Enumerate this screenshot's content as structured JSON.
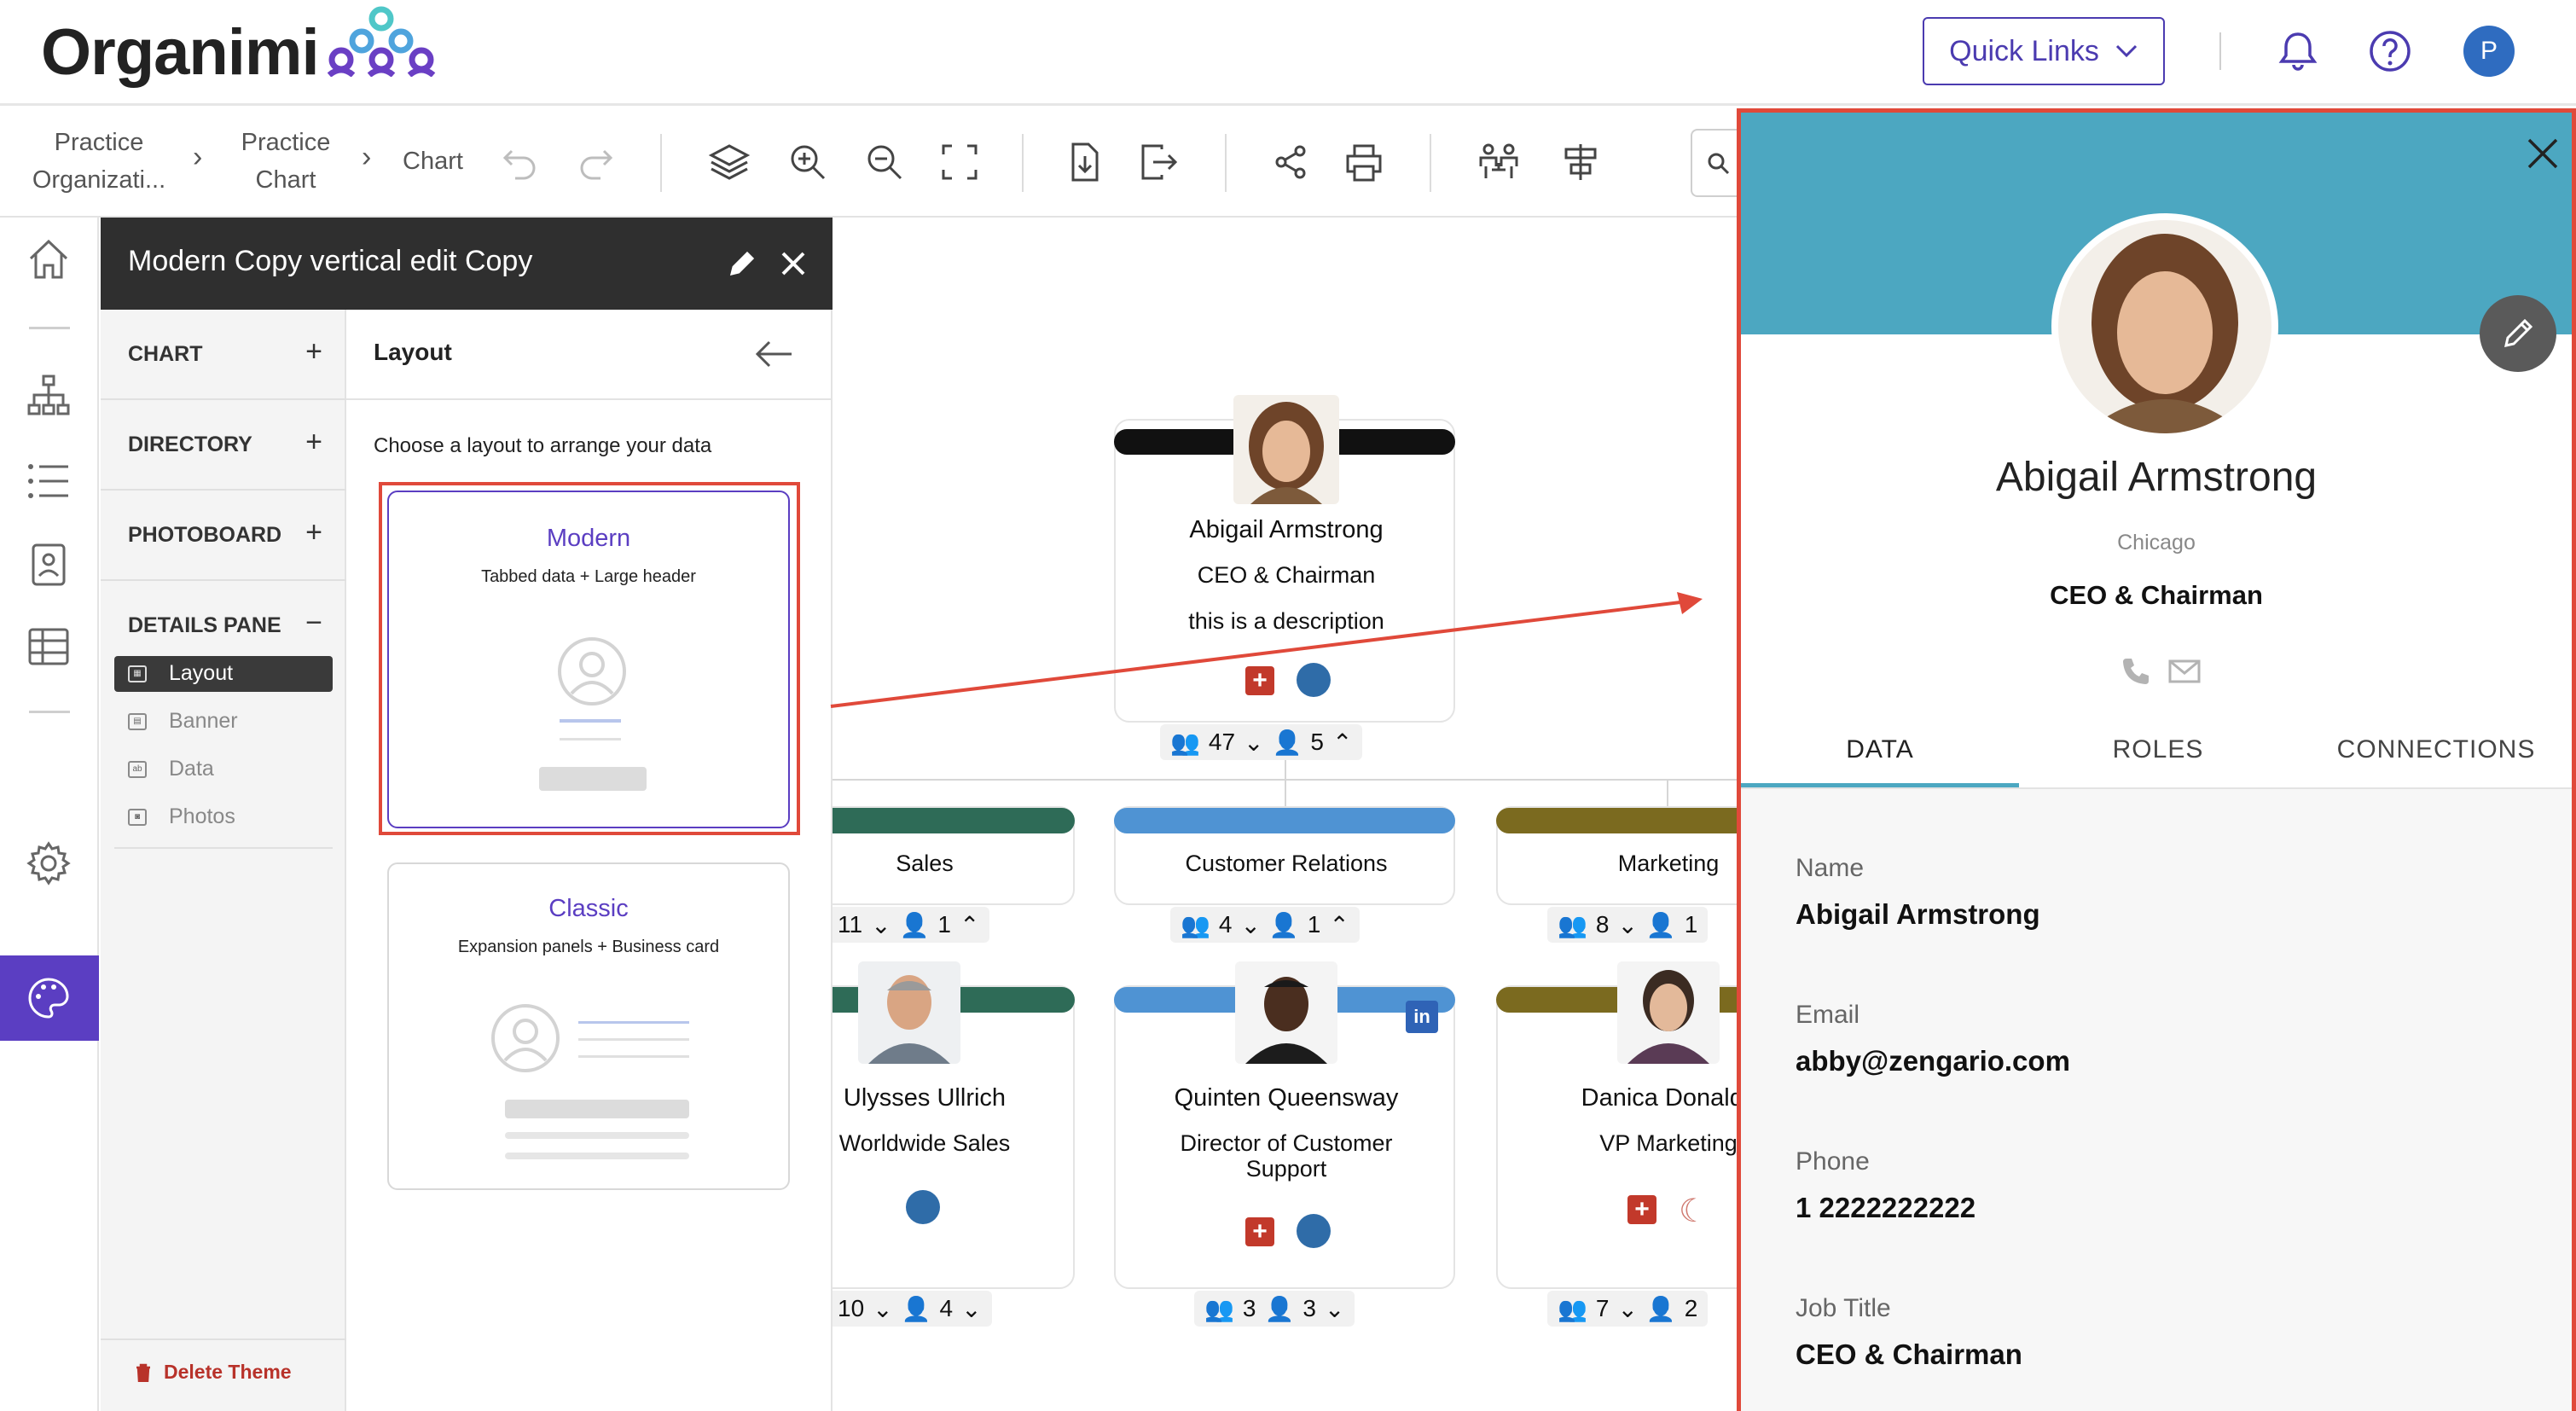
{
  "header": {
    "logo_text": "Organimi",
    "quick_links_label": "Quick Links",
    "user_initial": "P"
  },
  "breadcrumb": {
    "items": [
      {
        "line1": "Practice",
        "line2": "Organizati..."
      },
      {
        "line1": "Practice",
        "line2": "Chart"
      },
      {
        "line1": "Chart",
        "line2": ""
      }
    ]
  },
  "theme_panel": {
    "title": "Modern Copy vertical edit Copy",
    "sections": [
      {
        "label": "CHART",
        "sign": "+"
      },
      {
        "label": "DIRECTORY",
        "sign": "+"
      },
      {
        "label": "PHOTOBOARD",
        "sign": "+"
      },
      {
        "label": "DETAILS PANE",
        "sign": "−"
      }
    ],
    "sub_items": [
      {
        "label": "Layout",
        "active": true
      },
      {
        "label": "Banner",
        "active": false
      },
      {
        "label": "Data",
        "active": false
      },
      {
        "label": "Photos",
        "active": false
      }
    ],
    "delete_label": "Delete Theme"
  },
  "layout_pane": {
    "title": "Layout",
    "description": "Choose a layout to arrange your data",
    "options": [
      {
        "title": "Modern",
        "subtitle": "Tabbed data + Large header",
        "selected": true
      },
      {
        "title": "Classic",
        "subtitle": "Expansion panels + Business card",
        "selected": false
      }
    ]
  },
  "org_chart": {
    "root": {
      "name": "Abigail Armstrong",
      "title": "CEO & Chairman",
      "description": "this is a description",
      "total_count": "47",
      "direct_count": "5"
    },
    "departments": [
      {
        "name": "Sales",
        "total": "11",
        "direct": "1",
        "color": "#2e6b57"
      },
      {
        "name": "Customer Relations",
        "total": "4",
        "direct": "1",
        "color": "#4f93d3"
      },
      {
        "name": "Marketing",
        "total": "8",
        "direct": "1",
        "color": "#7b6a1f"
      }
    ],
    "people": [
      {
        "name": "Ulysses Ullrich",
        "title": "Worldwide Sales",
        "total": "10",
        "direct": "4"
      },
      {
        "name": "Quinten Queensway",
        "title": "Director of Customer Support",
        "total": "3",
        "direct": "3"
      },
      {
        "name": "Danica Donalds",
        "title": "VP Marketing",
        "total": "7",
        "direct": "2"
      }
    ]
  },
  "details": {
    "name": "Abigail Armstrong",
    "location": "Chicago",
    "title": "CEO & Chairman",
    "tabs": [
      "DATA",
      "ROLES",
      "CONNECTIONS"
    ],
    "active_tab": "DATA",
    "fields": [
      {
        "label": "Name",
        "value": "Abigail Armstrong"
      },
      {
        "label": "Email",
        "value": "abby@zengario.com"
      },
      {
        "label": "Phone",
        "value": "1 2222222222"
      },
      {
        "label": "Job Title",
        "value": "CEO & Chairman"
      }
    ],
    "banner_color": "#4ca7c1",
    "highlight_color": "#e0493a"
  }
}
